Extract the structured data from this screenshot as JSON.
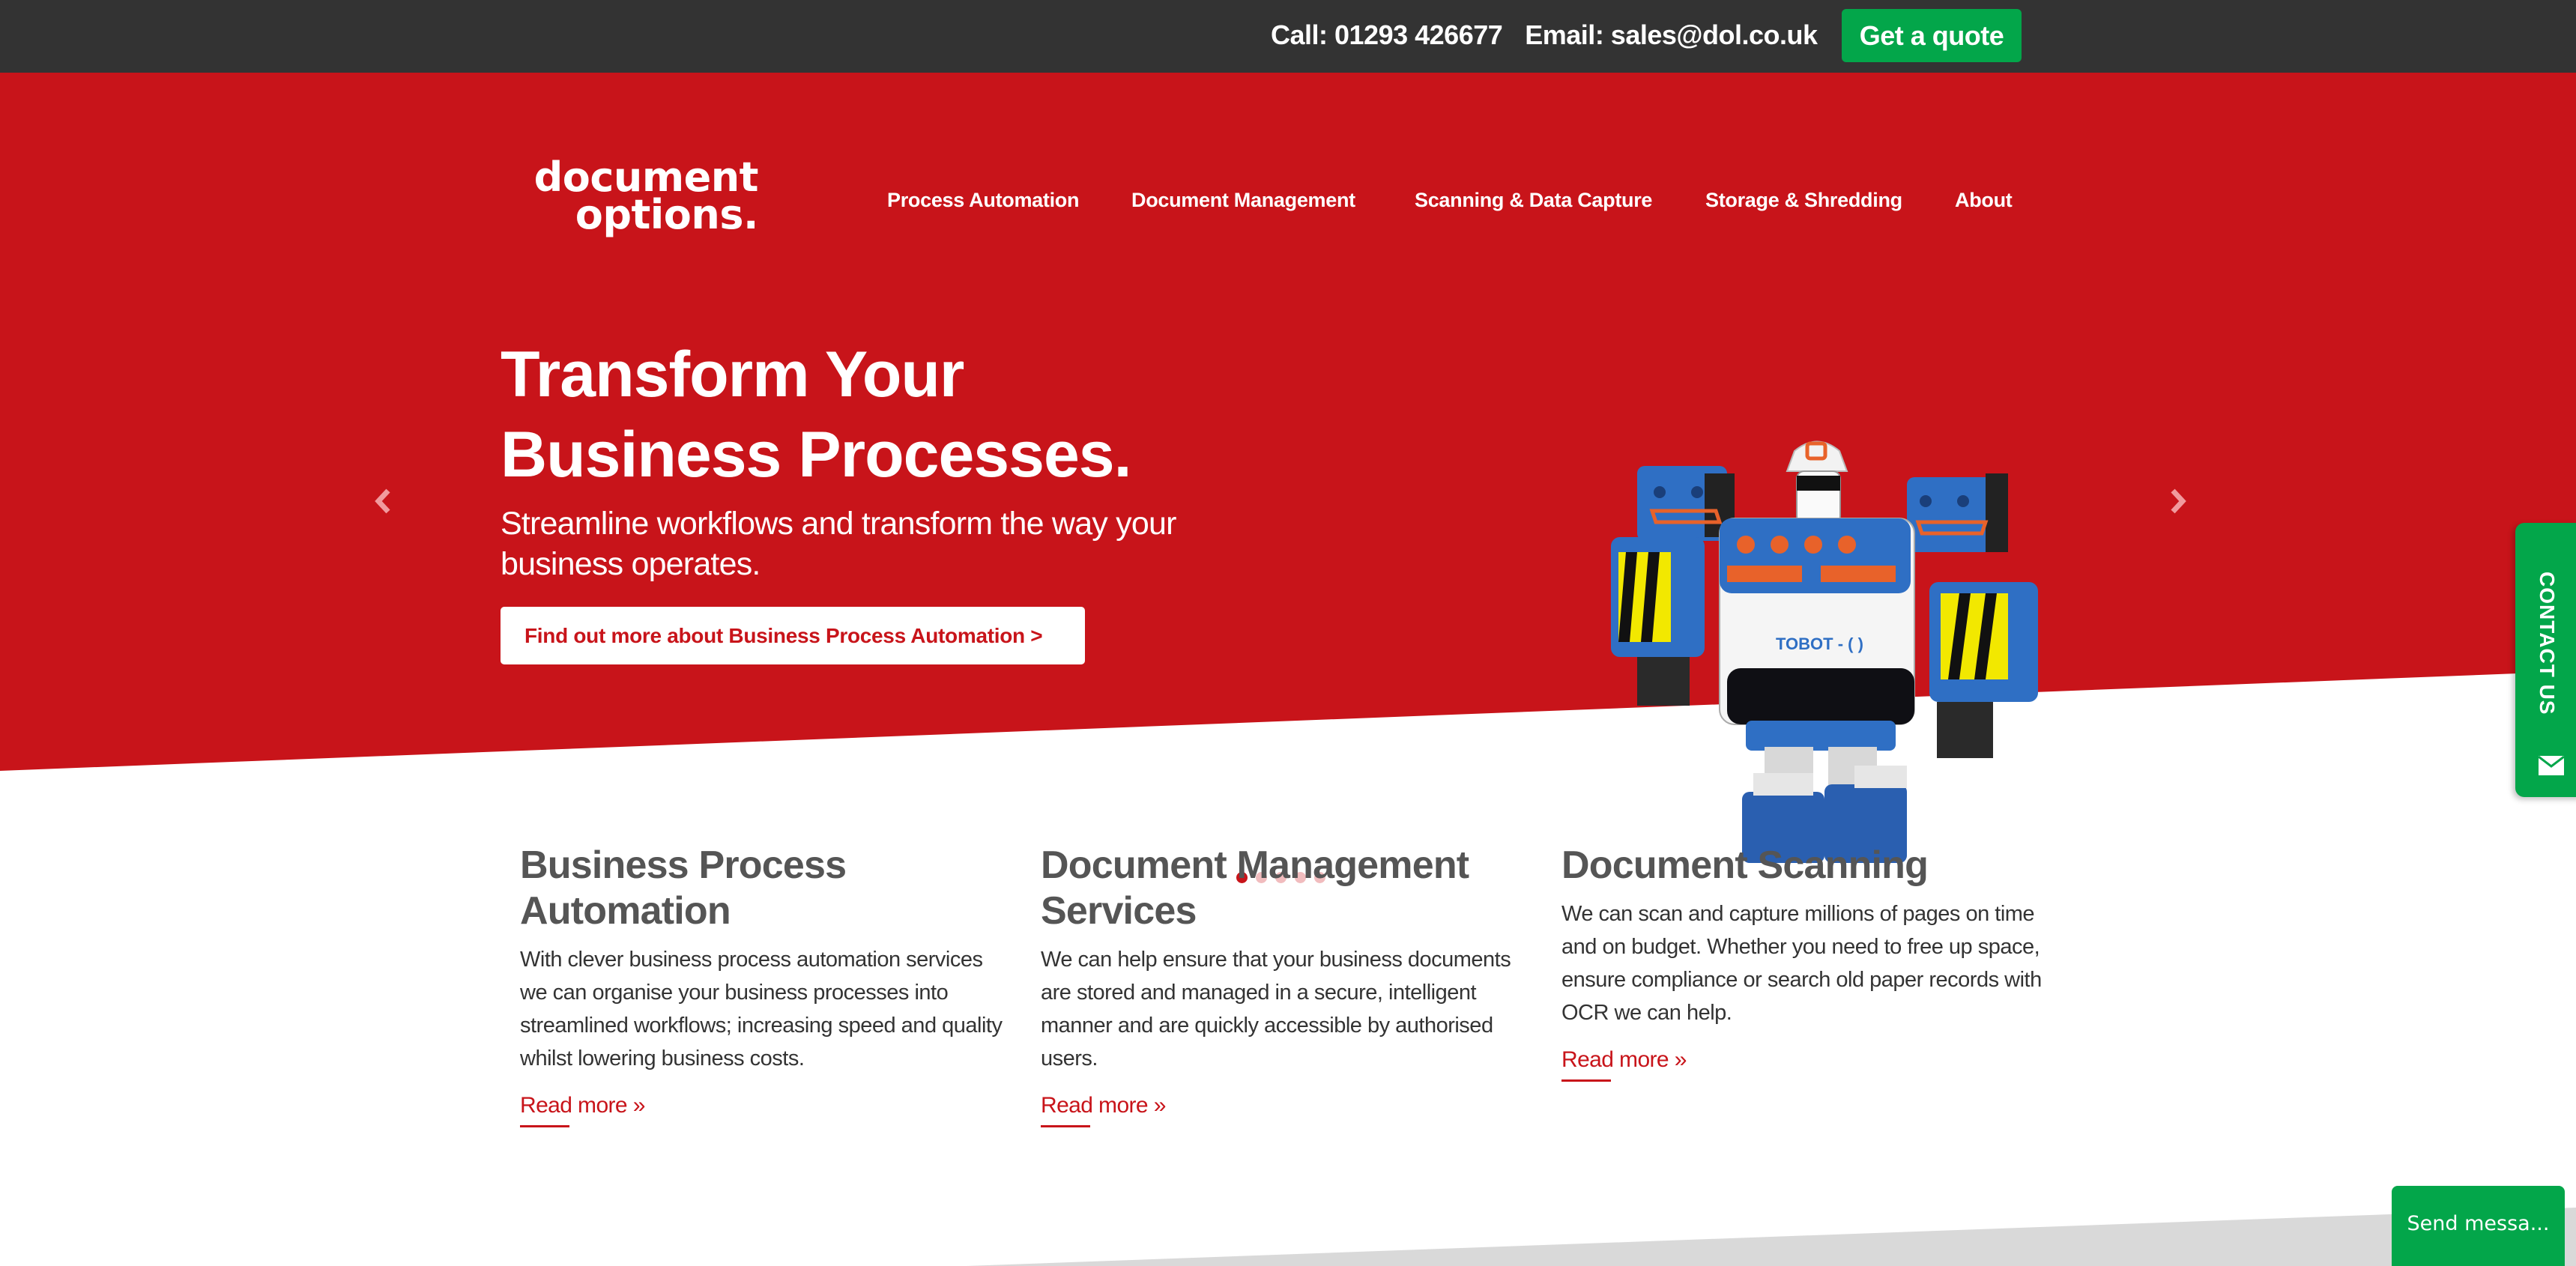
{
  "topbar": {
    "call": "Call: 01293 426677",
    "email": "Email: sales@dol.co.uk",
    "quote_button": "Get a quote"
  },
  "logo": {
    "line1": "document",
    "line2": "options."
  },
  "nav": {
    "items": [
      {
        "label": "Process Automation"
      },
      {
        "label": "Document Management"
      },
      {
        "label": "Scanning & Data Capture"
      },
      {
        "label": "Storage & Shredding"
      },
      {
        "label": "About"
      }
    ]
  },
  "hero": {
    "title_line1": "Transform Your",
    "title_line2": "Business Processes.",
    "subtitle": "Streamline workflows and transform the way your business operates.",
    "cta": "Find out more about Business Process Automation >",
    "robot_label": "TOBOT - ( )",
    "slides_total": 5,
    "active_slide": 1
  },
  "colors": {
    "brand_red": "#c8141a",
    "topbar_dark": "#333333",
    "accent_green": "#03a64a",
    "heading_grey": "#555555"
  },
  "services": [
    {
      "title": "Business Process Automation",
      "body": "With clever business process automation services we can organise your business processes into streamlined workflows; increasing speed and quality whilst lowering business costs.",
      "link": "Read more »"
    },
    {
      "title": "Document Management Services",
      "body": "We can help ensure that your business documents are stored and managed in a secure, intelligent manner and are quickly accessible by authorised users.",
      "link": "Read more »"
    },
    {
      "title": "Document Scanning",
      "body": "We can scan and capture millions of pages on time and on budget. Whether you need to free up space, ensure compliance or search old paper records with OCR we can help.",
      "link": "Read more »"
    }
  ],
  "contact_tab": {
    "label": "CONTACT US",
    "icon": "envelope-icon"
  },
  "chat": {
    "send_button": "Send messa..."
  }
}
